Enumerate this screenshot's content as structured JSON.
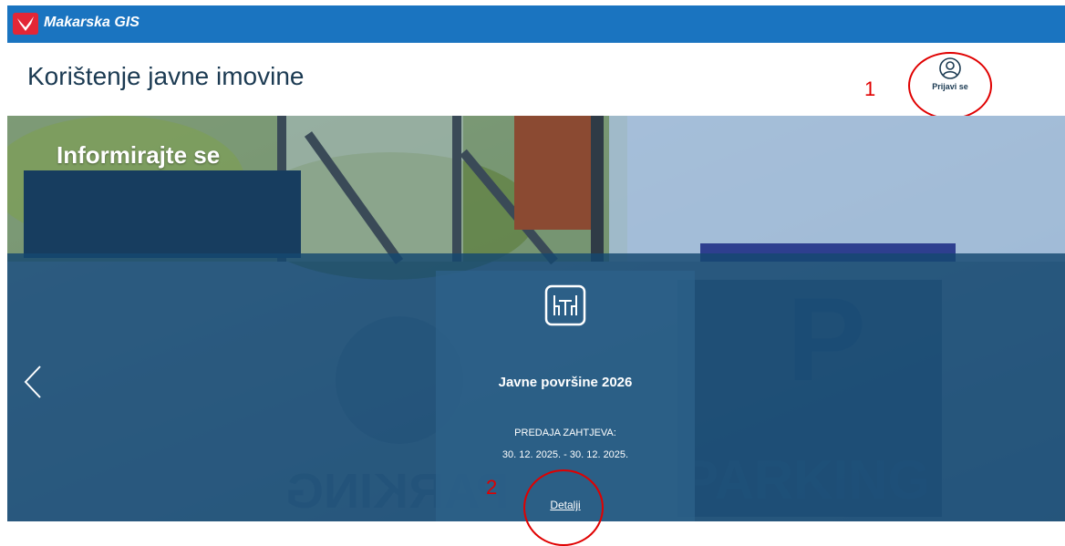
{
  "app": {
    "name": "Makarska GIS"
  },
  "header": {
    "title": "Korištenje javne imovine",
    "login_label": "Prijavi se"
  },
  "hero": {
    "section_title": "Informirajte se",
    "background_text": "PARKING"
  },
  "card": {
    "icon": "table-chairs-icon",
    "title": "Javne površine 2026",
    "label": "PREDAJA ZAHTJEVA:",
    "dates": "30. 12. 2025. - 30. 12. 2025.",
    "link": "Detalji"
  },
  "annotations": {
    "one": "1",
    "two": "2"
  },
  "colors": {
    "topbar": "#1a74c0",
    "title": "#1b3a52",
    "band": "#154870",
    "annotation": "#e00000"
  }
}
